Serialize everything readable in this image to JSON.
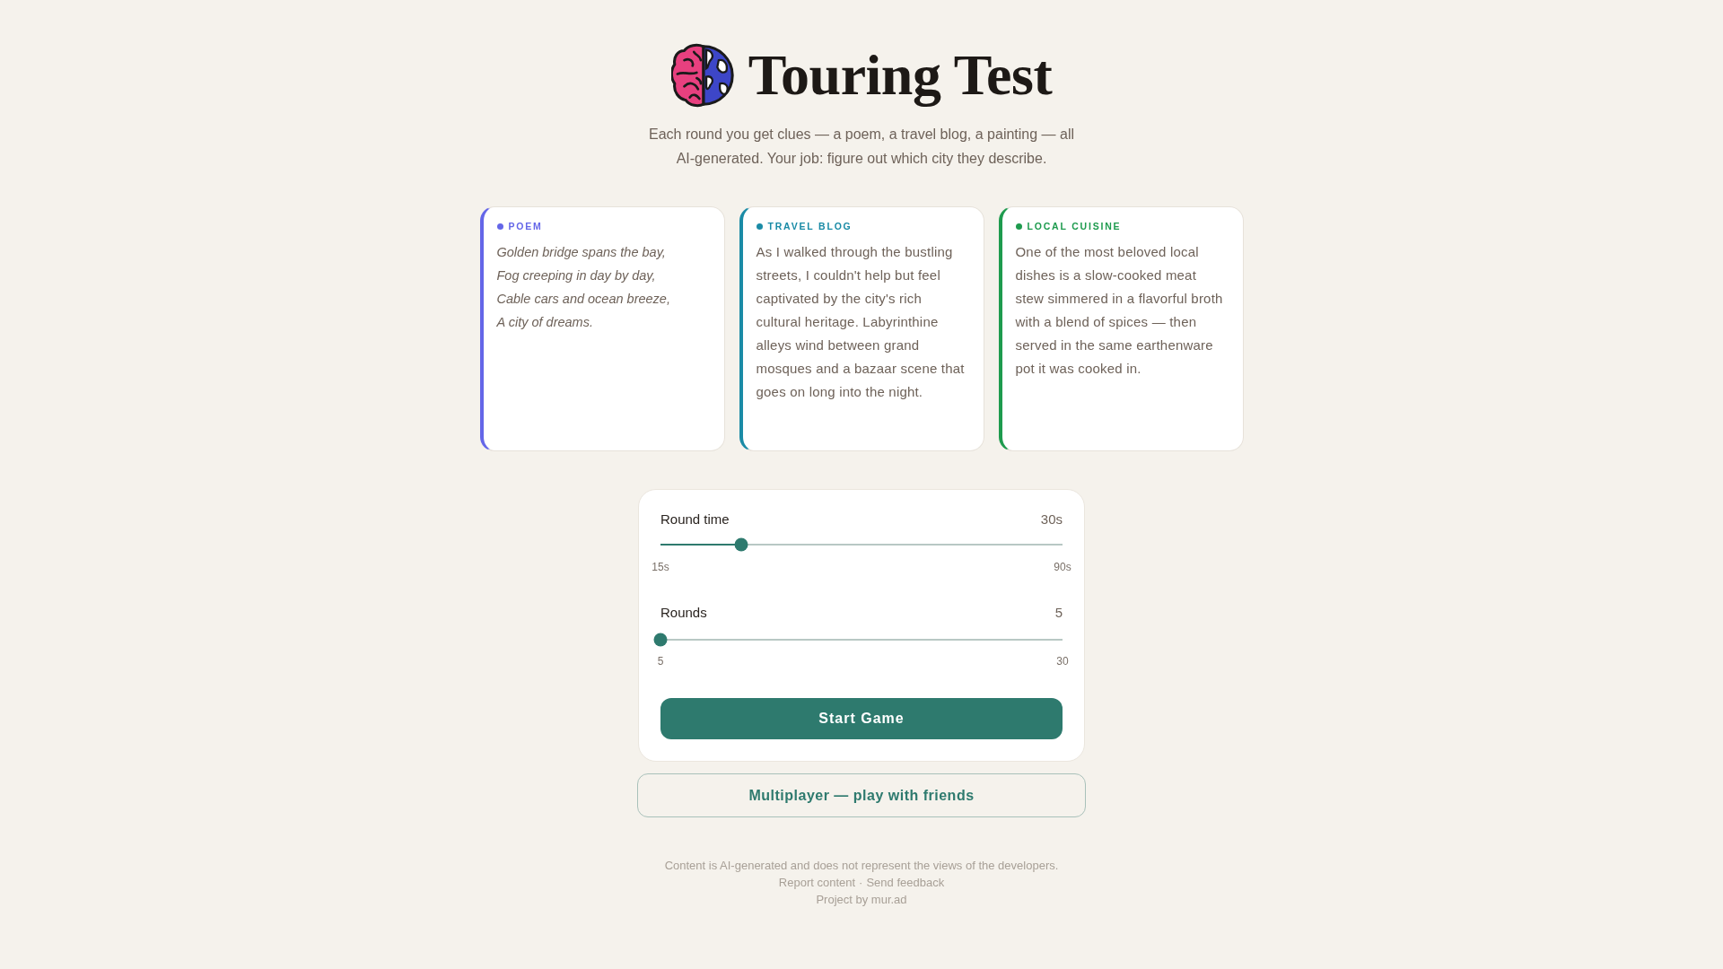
{
  "header": {
    "title": "Touring Test",
    "subtitle": "Each round you get clues — a poem, a travel blog, a painting — all AI-generated. Your job: figure out which city they describe."
  },
  "clues": [
    {
      "kind": "poem",
      "label": "POEM",
      "color": "#6466e8",
      "lines": [
        "Golden bridge spans the bay,",
        "Fog creeping in day by day,",
        "Cable cars and ocean breeze,",
        "A city of dreams."
      ]
    },
    {
      "kind": "prose",
      "label": "TRAVEL BLOG",
      "color": "#1a8ba6",
      "text": "As I walked through the bustling streets, I couldn't help but feel captivated by the city's rich cultural heritage. Labyrinthine alleys wind between grand mosques and a bazaar scene that goes on long into the night."
    },
    {
      "kind": "prose",
      "label": "LOCAL CUISINE",
      "color": "#1e9b4e",
      "text": "One of the most beloved local dishes is a slow-cooked meat stew simmered in a flavorful broth with a blend of spices — then served in the same earthenware pot it was cooked in."
    }
  ],
  "settings": {
    "sliders": [
      {
        "label": "Round time",
        "value": "30s",
        "level": 0.2,
        "min_label": "15s",
        "max_label": "90s"
      },
      {
        "label": "Rounds",
        "value": "5",
        "level": 0,
        "min_label": "5",
        "max_label": "30"
      }
    ],
    "start_button": "Start Game"
  },
  "multiplayer_button": "Multiplayer — play with friends",
  "footer": {
    "disclaimer": "Content is AI-generated and does not represent the views of the developers.",
    "links": [
      "Report content",
      "Send feedback"
    ],
    "link_separator": "·",
    "credit": "Project by mur.ad"
  }
}
